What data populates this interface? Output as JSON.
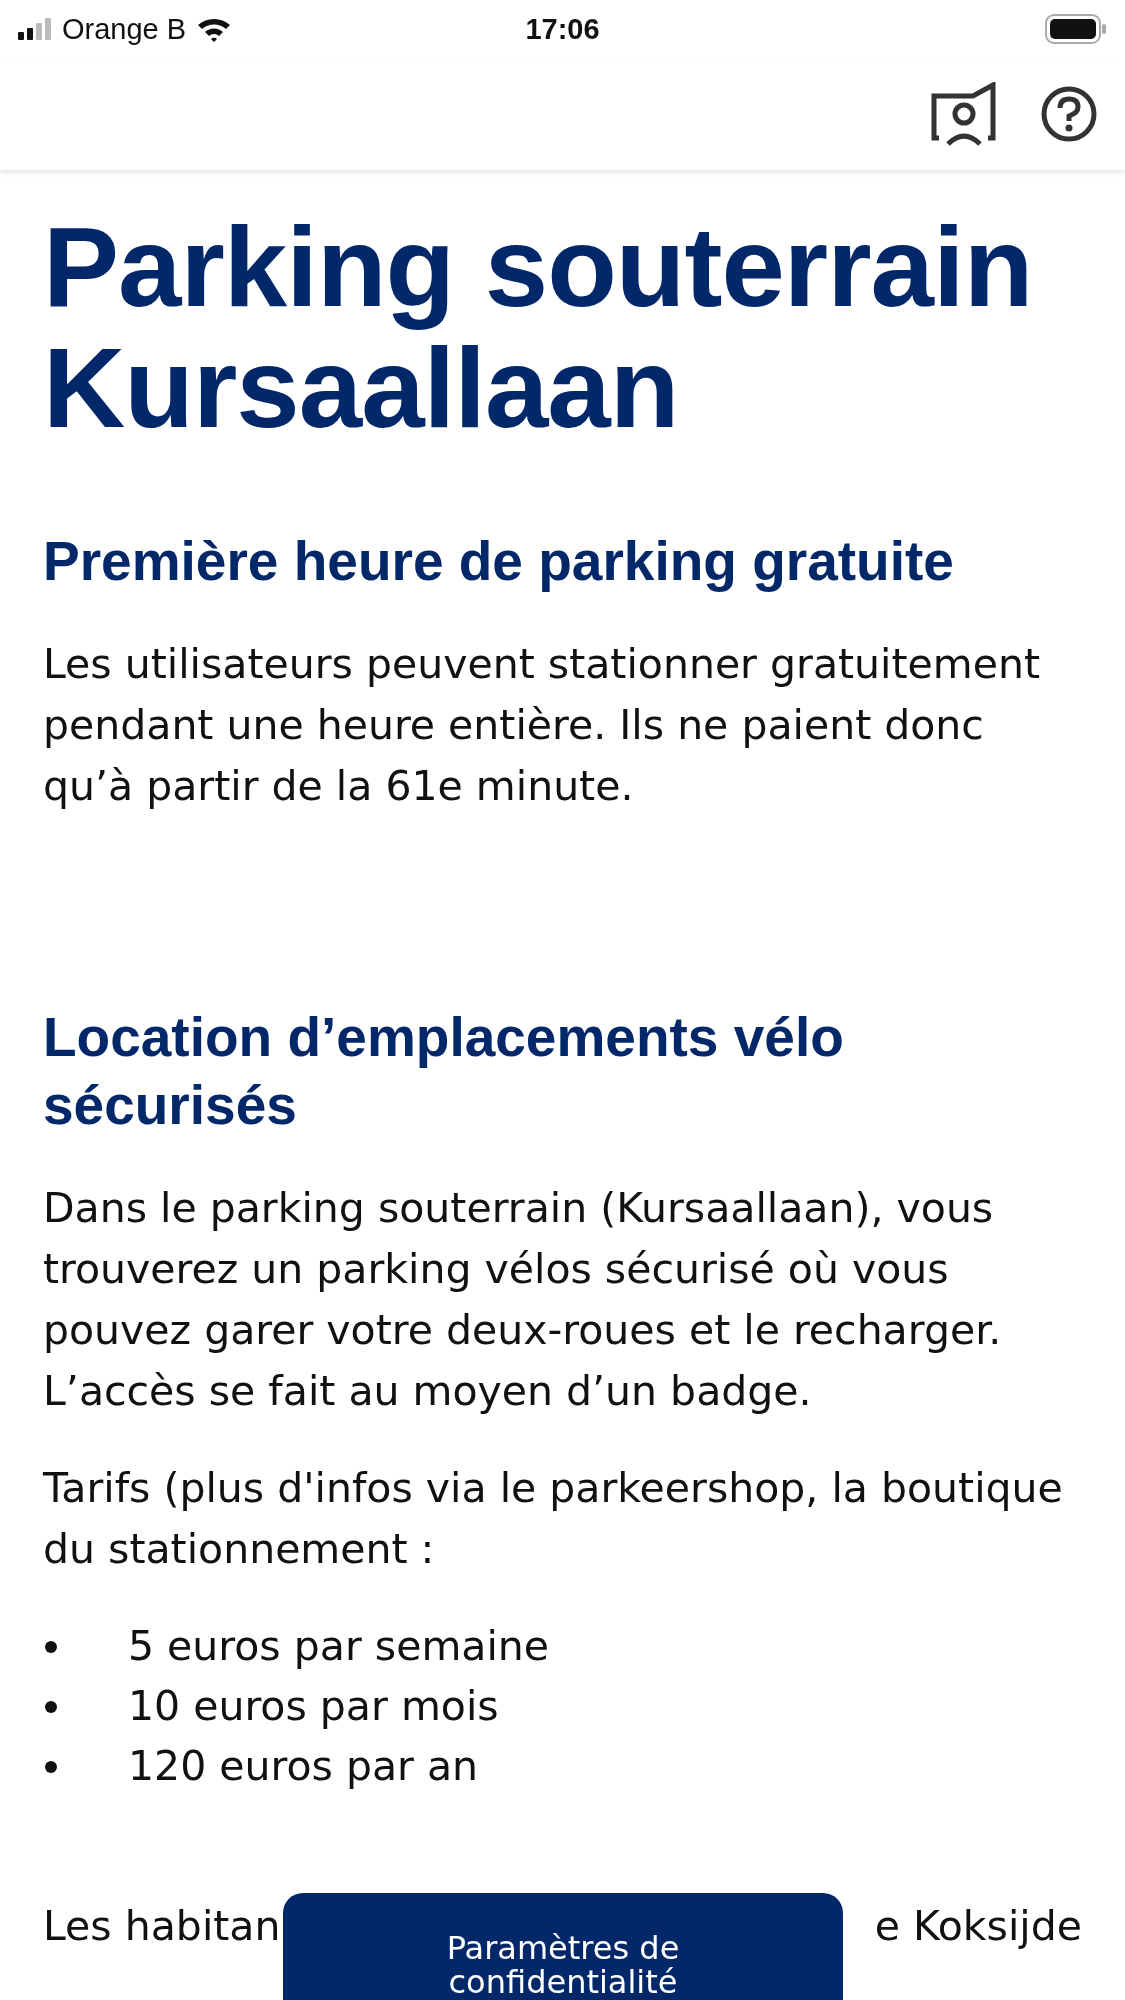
{
  "status_bar": {
    "carrier": "Orange B",
    "time": "17:06"
  },
  "title": "Parking souterrain Kursaallaan",
  "sections": [
    {
      "heading": "Première heure de parking gratuite",
      "paragraphs": [
        "Les utilisateurs peuvent stationner gratuitement pendant une heure entière. Ils ne paient donc qu’à partir de la 61e minute."
      ]
    },
    {
      "heading": "Location d’emplacements vélo sécurisés",
      "paragraphs": [
        "Dans le parking souterrain (Kursaallaan), vous trouverez un parking vélos sécurisé où vous pouvez garer votre deux-roues et le recharger. L’accès se fait au moyen d’un badge.",
        "Tarifs (plus d'infos via le parkeershop, la boutique du stationnement :"
      ],
      "bullets": [
        "5 euros par semaine",
        "10 euros par mois",
        "120 euros par an"
      ]
    }
  ],
  "last_paragraph": {
    "left": "Les habitan",
    "right": "e Koksijde"
  },
  "privacy_button": "Paramètres de confidentialité"
}
